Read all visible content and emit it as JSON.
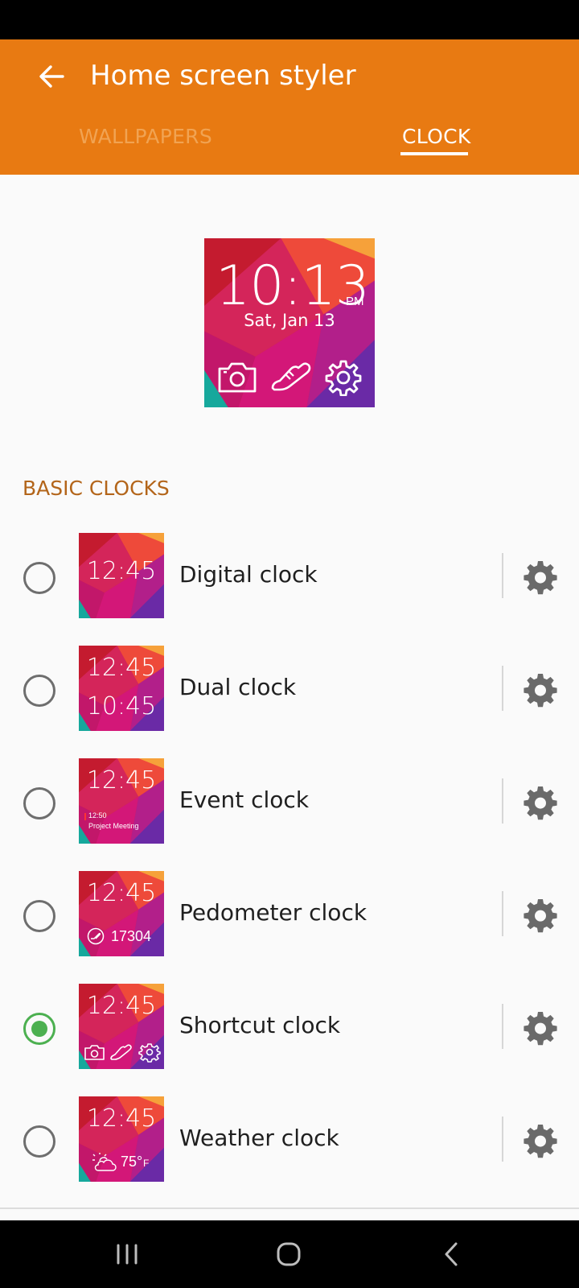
{
  "app_bar": {
    "title": "Home screen styler",
    "tabs": [
      {
        "label": "WALLPAPERS",
        "selected": false
      },
      {
        "label": "CLOCK",
        "selected": true
      }
    ]
  },
  "preview": {
    "time": "10:13",
    "ampm": "PM",
    "date": "Sat, Jan 13",
    "icons": [
      "camera-icon",
      "shoe-icon",
      "gear-icon"
    ]
  },
  "section": {
    "title": "BASIC CLOCKS"
  },
  "clocks": [
    {
      "label": "Digital clock",
      "time": "12:45",
      "selected": false
    },
    {
      "label": "Dual clock",
      "time": "12:45",
      "time2": "10:45",
      "selected": false
    },
    {
      "label": "Event clock",
      "time": "12:45",
      "event_time": "12:50",
      "event_title": "Project Meeting",
      "selected": false
    },
    {
      "label": "Pedometer clock",
      "time": "12:45",
      "steps": "17304",
      "selected": false
    },
    {
      "label": "Shortcut clock",
      "time": "12:45",
      "selected": true
    },
    {
      "label": "Weather clock",
      "time": "12:45",
      "temp": "75°",
      "temp_unit": "F",
      "selected": false
    }
  ],
  "colors": {
    "accent": "#e87a12",
    "section_header": "#b3651a",
    "radio_selected": "#4cb050"
  },
  "nav_bar": {
    "buttons": [
      "recents-icon",
      "home-icon",
      "back-icon"
    ]
  }
}
